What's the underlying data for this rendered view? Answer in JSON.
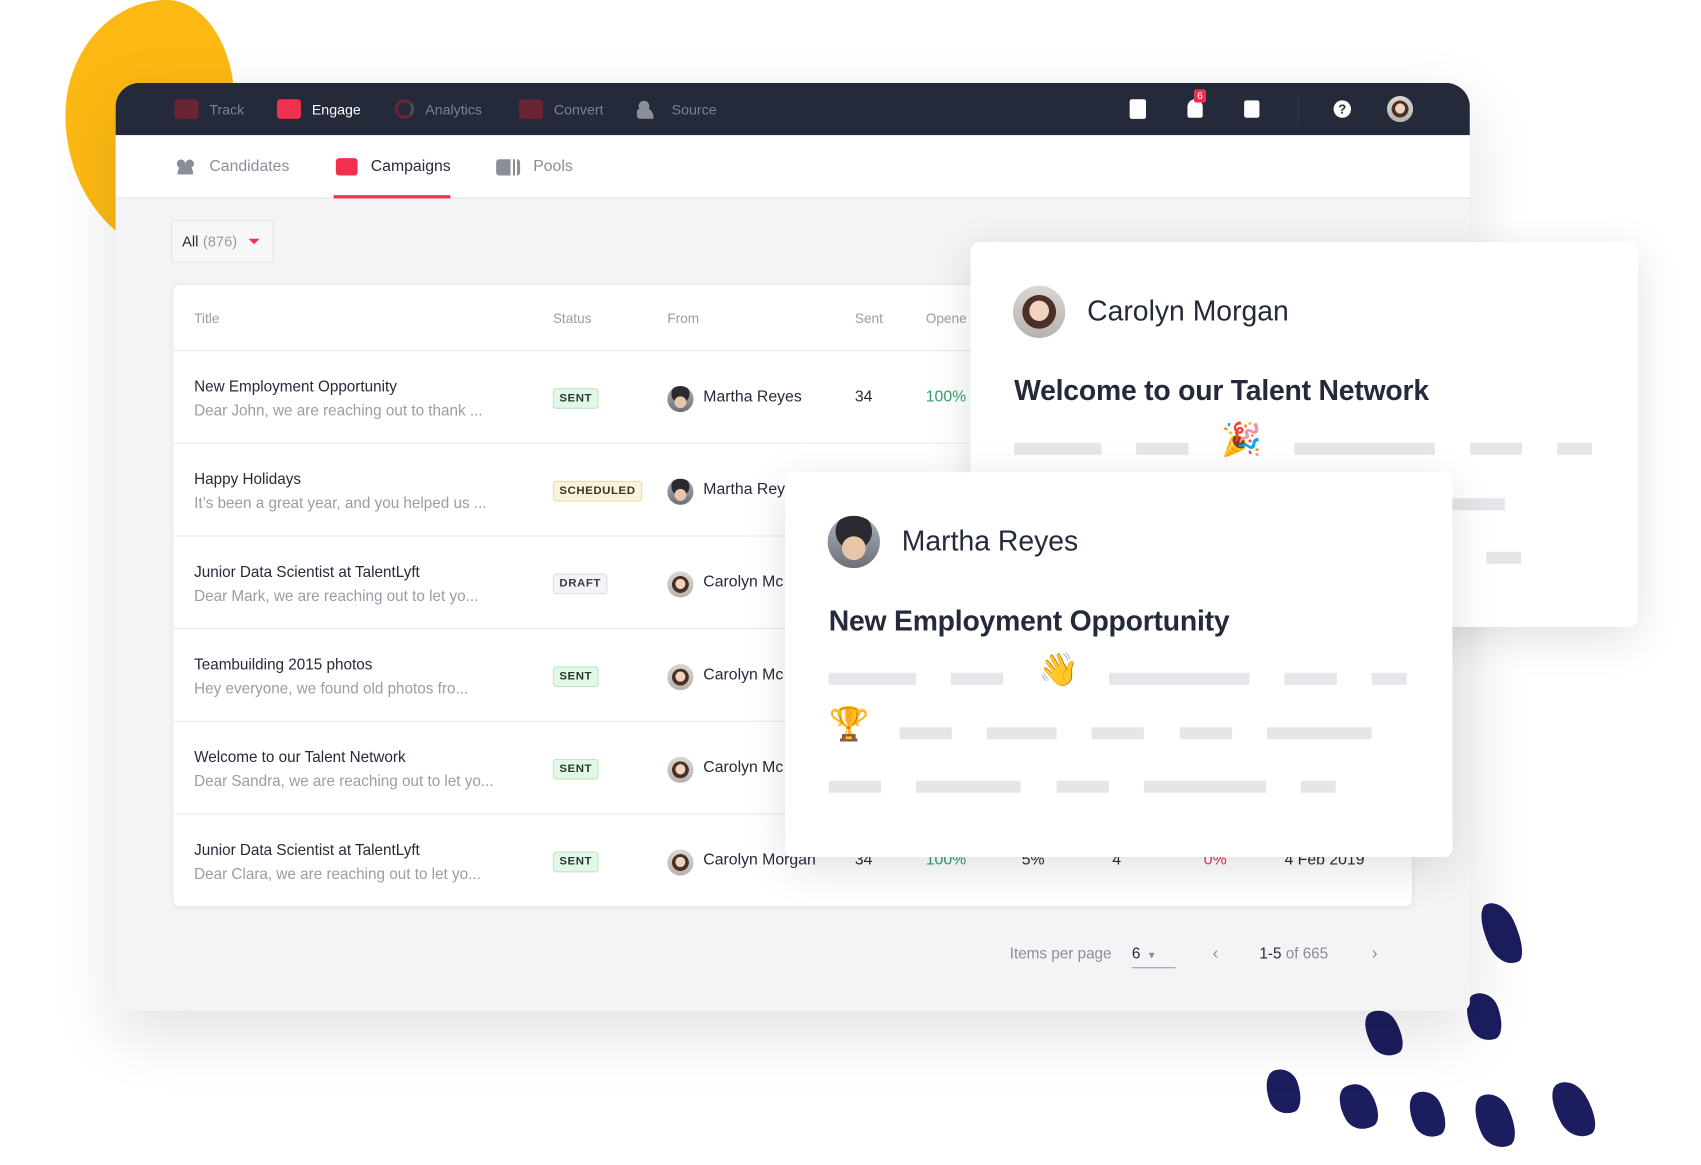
{
  "colors": {
    "accent": "#f0304f",
    "nav_bg": "#242a3a",
    "yellow": "#fdb913",
    "navy": "#1c1d5e",
    "positive": "#2ea36b"
  },
  "nav": {
    "items": [
      {
        "label": "Track",
        "icon": "track-icon"
      },
      {
        "label": "Engage",
        "icon": "engage-icon",
        "active": true
      },
      {
        "label": "Analytics",
        "icon": "analytics-icon"
      },
      {
        "label": "Convert",
        "icon": "convert-icon"
      },
      {
        "label": "Source",
        "icon": "source-icon"
      }
    ],
    "notification_count": "6"
  },
  "tabs": [
    {
      "label": "Candidates"
    },
    {
      "label": "Campaigns",
      "active": true
    },
    {
      "label": "Pools"
    }
  ],
  "filter": {
    "label": "All",
    "count": "(876)"
  },
  "table": {
    "headers": [
      "Title",
      "Status",
      "From",
      "Sent",
      "Opene"
    ],
    "rows": [
      {
        "title": "New Employment Opportunity",
        "preview": "Dear John, we are reaching out to thank ...",
        "status": "SENT",
        "from": "Martha Reyes",
        "sent": "34",
        "opened": "100%"
      },
      {
        "title": "Happy Holidays",
        "preview": "It’s been a great year, and you helped us ...",
        "status": "SCHEDULED",
        "from": "Martha Rey"
      },
      {
        "title": "Junior Data Scientist at TalentLyft",
        "preview": "Dear Mark, we are reaching out to let yo...",
        "status": "DRAFT",
        "from": "Carolyn Mc"
      },
      {
        "title": "Teambuilding 2015 photos",
        "preview": "Hey everyone, we found old photos fro...",
        "status": "SENT",
        "from": "Carolyn Mc"
      },
      {
        "title": "Welcome to our Talent Network",
        "preview": "Dear Sandra, we are reaching out to let yo...",
        "status": "SENT",
        "from": "Carolyn Mc"
      },
      {
        "title": "Junior Data Scientist at TalentLyft",
        "preview": "Dear Clara, we are reaching out to let yo...",
        "status": "SENT",
        "from": "Carolyn Morgan",
        "sent": "34",
        "opened": "100%",
        "c3": "5%",
        "c4": "4",
        "c5": "0%",
        "date": "4 Feb 2019"
      }
    ]
  },
  "pagination": {
    "items_per_page_label": "Items per page",
    "items_per_page": "6",
    "range": "1-5",
    "of": "of 665"
  },
  "email_cards": [
    {
      "sender": "Carolyn Morgan",
      "subject": "Welcome to our Talent Network",
      "emoji": "🎉"
    },
    {
      "sender": "Martha Reyes",
      "subject": "New Employment Opportunity",
      "emoji": "👋",
      "emoji2": "🏆"
    }
  ]
}
